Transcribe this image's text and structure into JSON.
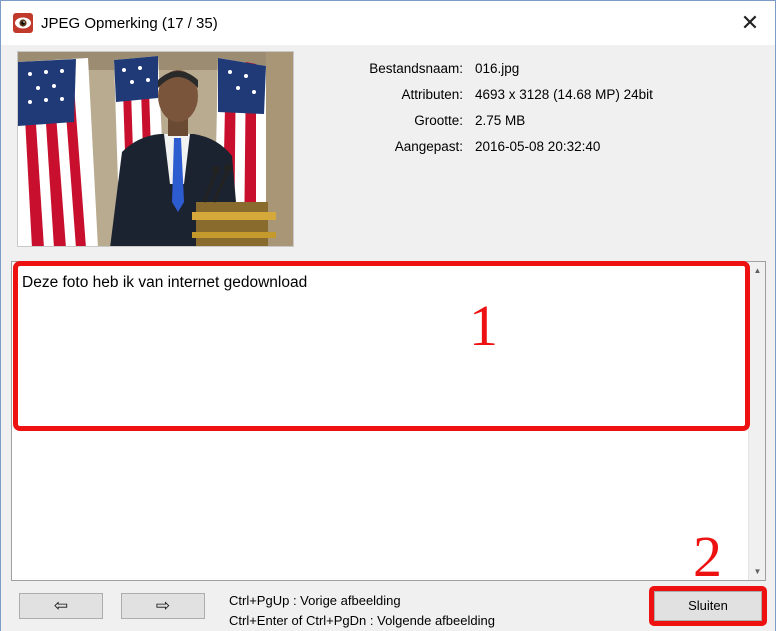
{
  "window": {
    "title": "JPEG Opmerking  (17 / 35)",
    "close_symbol": "✕"
  },
  "file_info": [
    {
      "label": "Bestandsnaam:",
      "value": "016.jpg"
    },
    {
      "label": "Attributen:",
      "value": "4693 x 3128 (14.68 MP)  24bit"
    },
    {
      "label": "Grootte:",
      "value": "2.75 MB"
    },
    {
      "label": "Aangepast:",
      "value": "2016-05-08 20:32:40"
    }
  ],
  "comment": {
    "text": "Deze foto heb ik van internet gedownload"
  },
  "annotations": {
    "marker1": "1",
    "marker2": "2",
    "color": "#ee1111"
  },
  "footer": {
    "prev_symbol": "⇦",
    "next_symbol": "⇨",
    "hint_prev": "Ctrl+PgUp :  Vorige afbeelding",
    "hint_next": "Ctrl+Enter of Ctrl+PgDn :  Volgende afbeelding",
    "close_label": "Sluiten"
  },
  "icons": {
    "app": "eye-app-icon",
    "close": "close-icon",
    "scroll_up": "scroll-up-arrow-icon",
    "scroll_down": "scroll-down-arrow-icon"
  }
}
